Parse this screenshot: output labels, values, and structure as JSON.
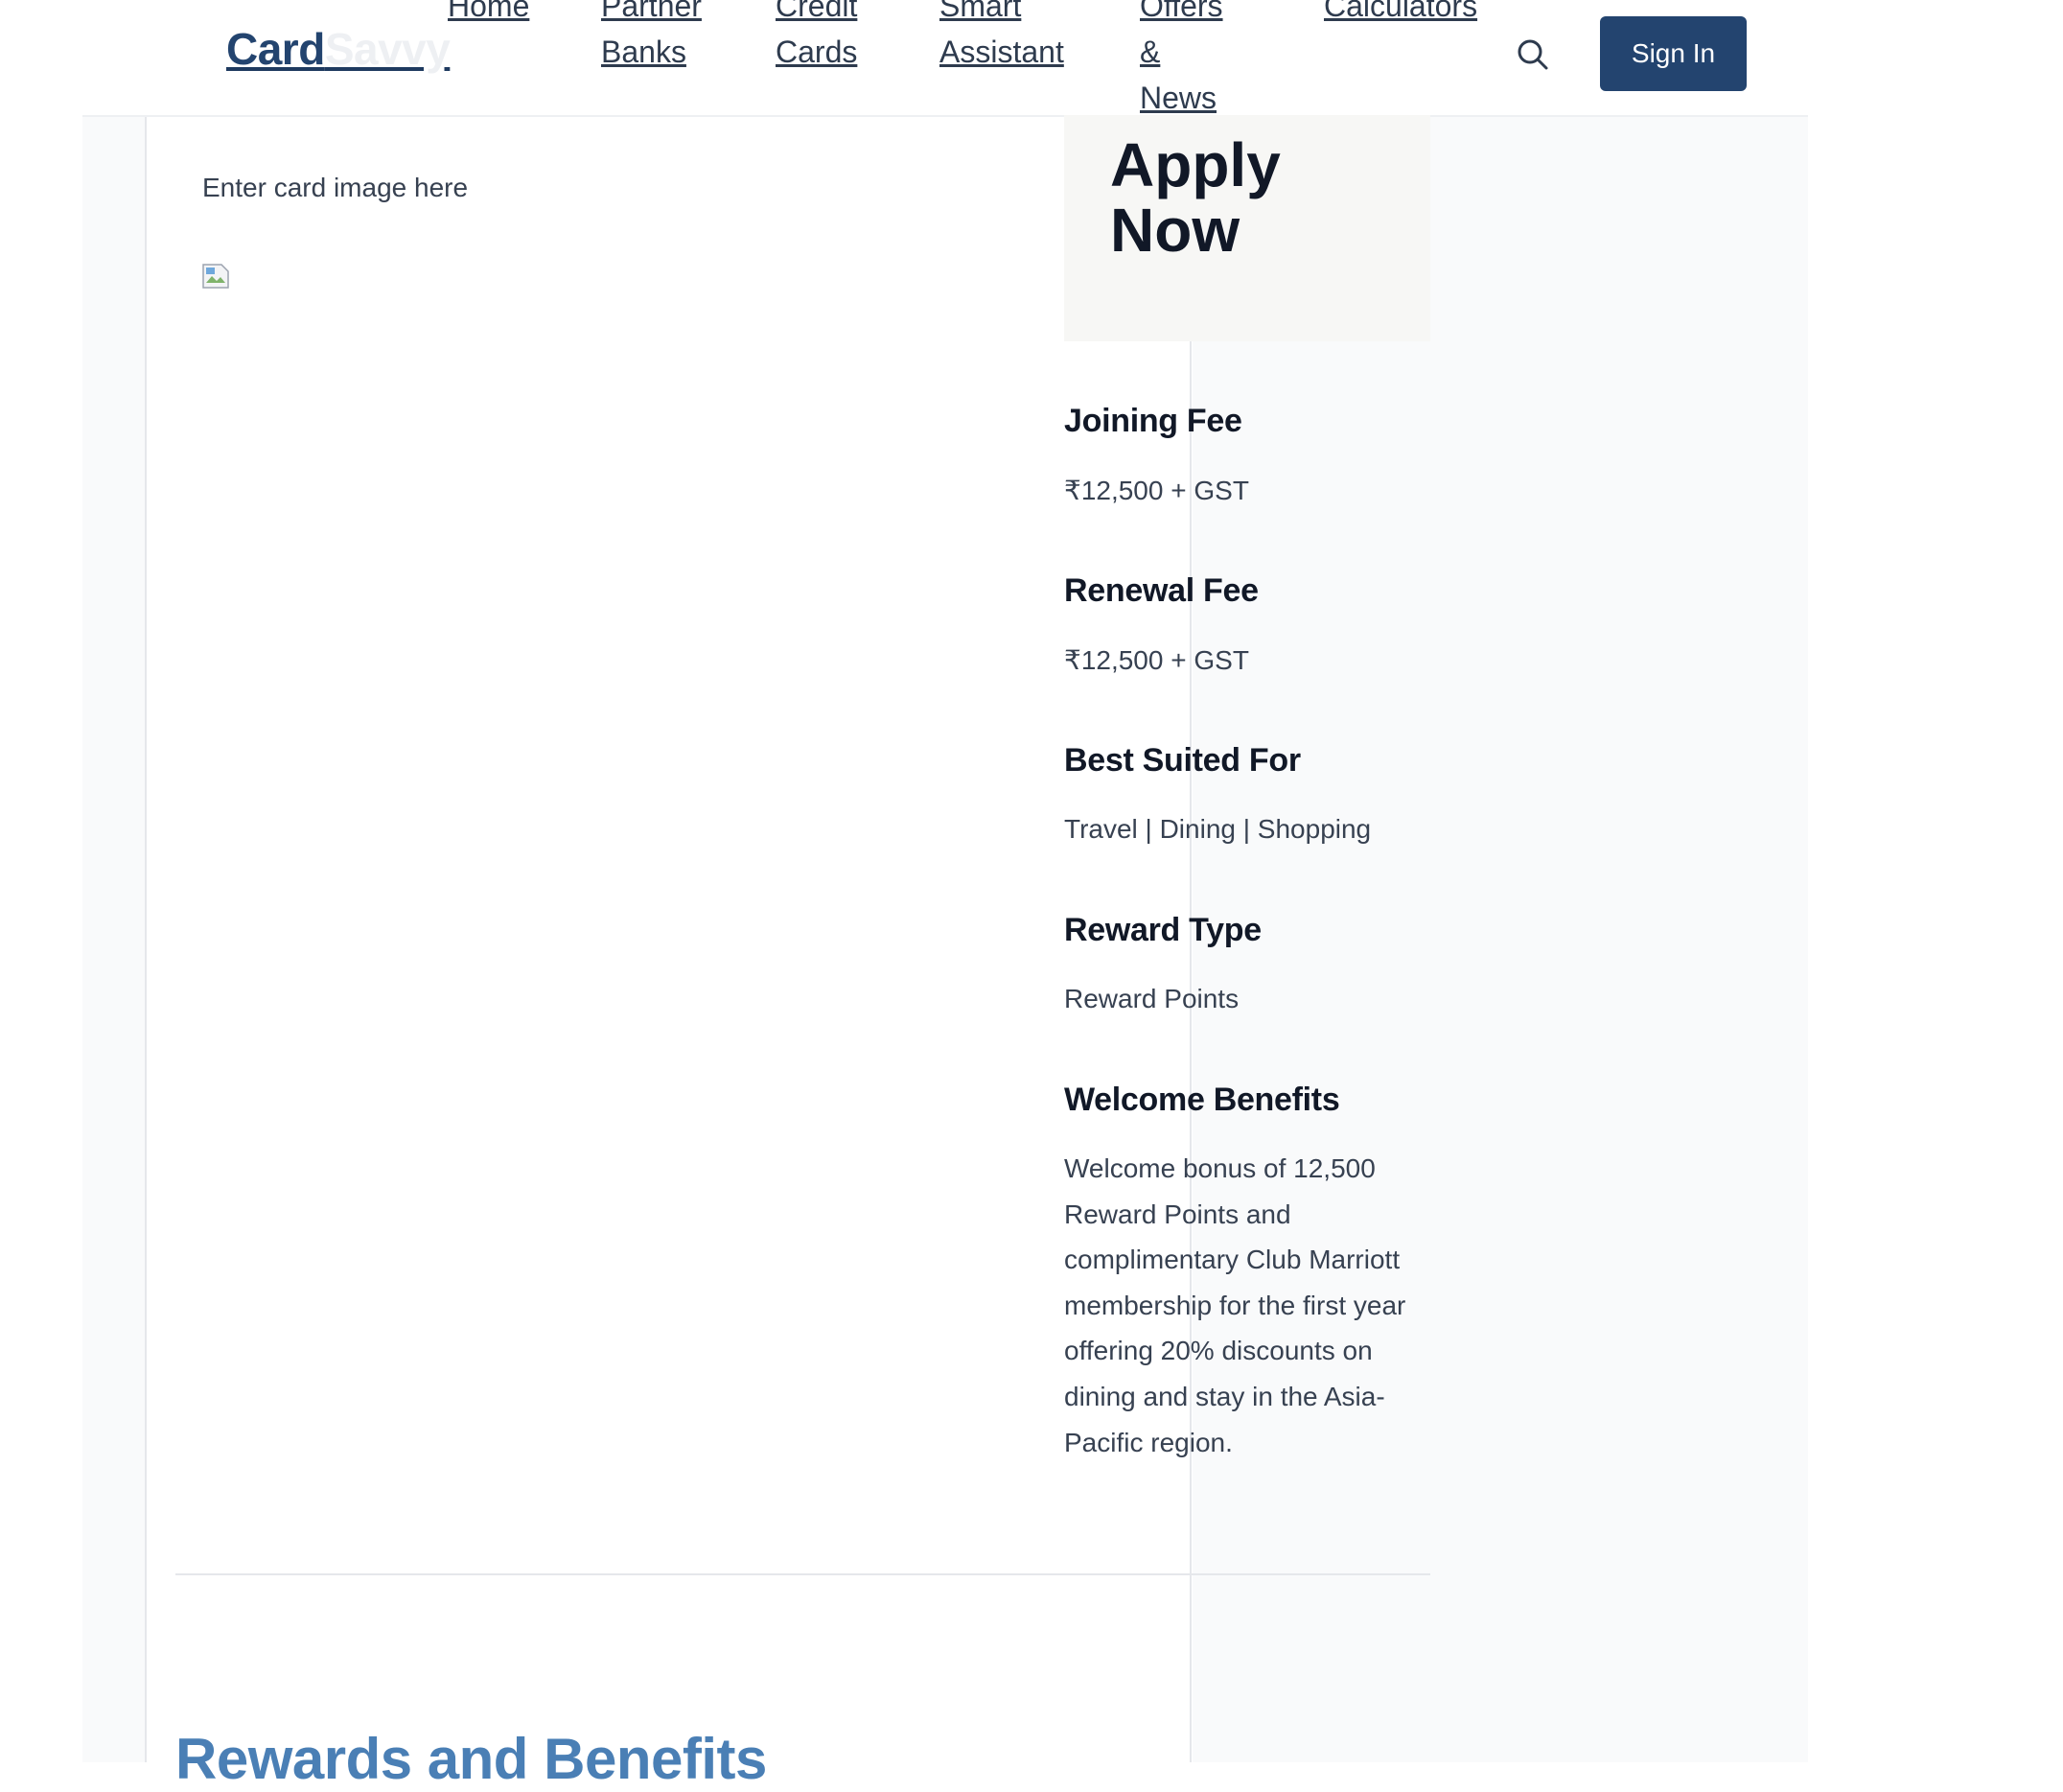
{
  "header": {
    "logo": {
      "part1": "Card",
      "part2": "Savvy"
    },
    "nav": [
      {
        "label": "Home"
      },
      {
        "label": "Partner\nBanks"
      },
      {
        "label": "Credit\nCards"
      },
      {
        "label": "Smart\nAssistant"
      },
      {
        "label": "Offers\n&\nNews"
      },
      {
        "label": "Calculators"
      }
    ],
    "search_icon": "search-icon",
    "sign_in_label": "Sign In"
  },
  "card_image": {
    "caption": "Enter card image here",
    "image_icon": "broken-image-icon"
  },
  "apply": {
    "title": "Apply Now"
  },
  "details": [
    {
      "label": "Joining Fee",
      "value": "₹12,500 + GST"
    },
    {
      "label": "Renewal Fee",
      "value": "₹12,500 + GST"
    },
    {
      "label": "Best Suited For",
      "value": "Travel | Dining | Shopping"
    },
    {
      "label": "Reward Type",
      "value": "Reward Points"
    },
    {
      "label": "Welcome Benefits",
      "value": "Welcome bonus of 12,500 Reward Points and complimentary Club Marriott membership for the first year offering 20% discounts on dining and stay in the Asia-Pacific region."
    }
  ],
  "rewards_section": {
    "heading": "Rewards and Benefits"
  },
  "colors": {
    "brand": "#23446f",
    "heading_accent": "#4a7fb5",
    "page_bg": "#f9fafb"
  }
}
